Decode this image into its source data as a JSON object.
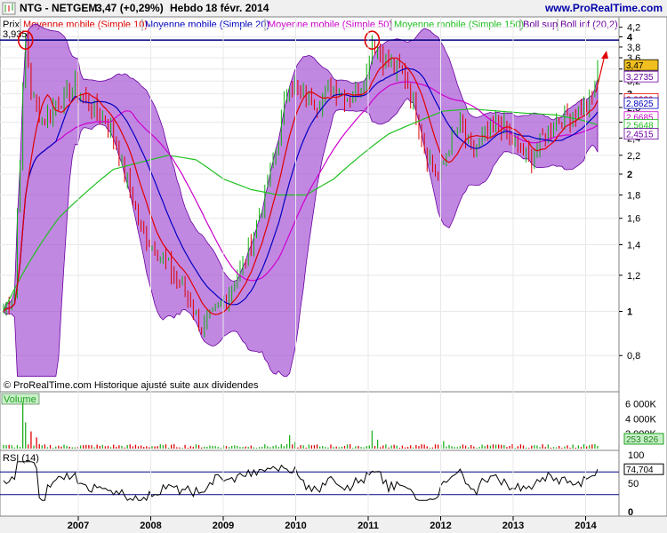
{
  "header": {
    "title": "NTG - NETGEM",
    "price_change": "3,47 (+0,29%)",
    "period": "Hebdo",
    "date": "18 févr. 2014",
    "brand": "www.ProRealTime.com"
  },
  "legend": {
    "prix": "Prix",
    "items": [
      {
        "label": "Moyenne mobile (Simple 10)",
        "color": "#e00000"
      },
      {
        "label": "Moyenne mobile (Simple 20)",
        "color": "#0000c0"
      },
      {
        "label": "Moyenne mobile (Simple 50)",
        "color": "#cc00cc"
      },
      {
        "label": "Moyenne mobile (Simple 150)",
        "color": "#20c020"
      },
      {
        "label": "Boll sup",
        "color": "#6a00a0"
      },
      {
        "label": "Boll inf (20,2)",
        "color": "#6a00a0"
      }
    ]
  },
  "footer_note": "© ProRealTime.com  Historique ajusté suite aux dividendes",
  "chart_data": [
    {
      "type": "candlestick",
      "name": "price",
      "x_labels": [
        "2007",
        "2008",
        "2009",
        "2010",
        "2011",
        "2012",
        "2013",
        "2014"
      ],
      "y_ticks": [
        "0,8",
        "1",
        "1,2",
        "1,4",
        "1,6",
        "1,8",
        "2",
        "2,2",
        "2,4",
        "2,6",
        "2,8",
        "3",
        "3,2",
        "3,4",
        "3,6",
        "3,8",
        "4",
        "4,2"
      ],
      "ylim": [
        0.7,
        4.25
      ],
      "y_scale": "log",
      "resistance_level": 3.935,
      "resistance_label": "3,935",
      "value_tags": [
        {
          "label": "3,47",
          "value": 3.47,
          "color": "#000000",
          "bg": "#f0c020"
        },
        {
          "label": "3,2735",
          "value": 3.2735,
          "color": "#6a00a0",
          "bg": "#ffffff"
        },
        {
          "label": "2,9239",
          "value": 2.9239,
          "color": "#e00000",
          "bg": "#ffffff"
        },
        {
          "label": "2,8625",
          "value": 2.8625,
          "color": "#0000c0",
          "bg": "#ffffff"
        },
        {
          "label": "2,6685",
          "value": 2.6685,
          "color": "#cc00cc",
          "bg": "#ffffff"
        },
        {
          "label": "2,5648",
          "value": 2.5648,
          "color": "#20c020",
          "bg": "#ffffff"
        },
        {
          "label": "2,4515",
          "value": 2.4515,
          "color": "#6a00a0",
          "bg": "#ffffff"
        }
      ],
      "price_keypoints": [
        [
          0,
          1.0
        ],
        [
          4,
          1.1
        ],
        [
          6,
          2.2
        ],
        [
          8,
          3.935
        ],
        [
          10,
          3.0
        ],
        [
          14,
          2.6
        ],
        [
          20,
          2.9
        ],
        [
          26,
          3.1
        ],
        [
          32,
          2.8
        ],
        [
          38,
          2.6
        ],
        [
          44,
          2.0
        ],
        [
          50,
          1.5
        ],
        [
          56,
          1.35
        ],
        [
          62,
          1.2
        ],
        [
          68,
          1.05
        ],
        [
          72,
          0.92
        ],
        [
          76,
          0.98
        ],
        [
          82,
          1.1
        ],
        [
          88,
          1.3
        ],
        [
          94,
          1.7
        ],
        [
          100,
          2.4
        ],
        [
          104,
          3.2
        ],
        [
          108,
          3.0
        ],
        [
          114,
          2.9
        ],
        [
          120,
          3.1
        ],
        [
          126,
          2.95
        ],
        [
          132,
          3.3
        ],
        [
          134,
          3.935
        ],
        [
          138,
          3.6
        ],
        [
          142,
          3.4
        ],
        [
          146,
          3.3
        ],
        [
          150,
          2.7
        ],
        [
          154,
          2.2
        ],
        [
          158,
          1.95
        ],
        [
          162,
          2.3
        ],
        [
          166,
          2.6
        ],
        [
          170,
          2.2
        ],
        [
          174,
          2.4
        ],
        [
          180,
          2.6
        ],
        [
          186,
          2.3
        ],
        [
          192,
          2.15
        ],
        [
          196,
          2.4
        ],
        [
          200,
          2.6
        ],
        [
          206,
          2.7
        ],
        [
          212,
          2.8
        ],
        [
          214,
          2.95
        ],
        [
          216,
          3.47
        ]
      ],
      "ma150_keypoints": [
        [
          0,
          1.0
        ],
        [
          20,
          1.6
        ],
        [
          40,
          2.05
        ],
        [
          60,
          2.2
        ],
        [
          70,
          2.15
        ],
        [
          80,
          1.95
        ],
        [
          90,
          1.85
        ],
        [
          100,
          1.8
        ],
        [
          110,
          1.8
        ],
        [
          120,
          1.95
        ],
        [
          130,
          2.2
        ],
        [
          140,
          2.45
        ],
        [
          150,
          2.6
        ],
        [
          160,
          2.75
        ],
        [
          170,
          2.78
        ],
        [
          180,
          2.75
        ],
        [
          190,
          2.72
        ],
        [
          200,
          2.7
        ],
        [
          210,
          2.63
        ],
        [
          216,
          2.5648
        ]
      ]
    },
    {
      "type": "bar",
      "name": "volume",
      "label": "Volume",
      "y_ticks": [
        "2 000K",
        "4 000K",
        "6 000K"
      ],
      "ylim": [
        0,
        7000000
      ],
      "last_value_label": "253 826",
      "spikes": [
        {
          "idx": 7,
          "value": 6200000
        },
        {
          "idx": 8,
          "value": 3500000
        },
        {
          "idx": 10,
          "value": 2300000
        },
        {
          "idx": 12,
          "value": 1500000
        },
        {
          "idx": 104,
          "value": 1800000
        },
        {
          "idx": 106,
          "value": 900000
        },
        {
          "idx": 134,
          "value": 2400000
        },
        {
          "idx": 136,
          "value": 1200000
        },
        {
          "idx": 160,
          "value": 1000000
        },
        {
          "idx": 215,
          "value": 600000
        }
      ]
    },
    {
      "type": "line",
      "name": "rsi",
      "label": "RSI (14)",
      "y_ticks": [
        "0",
        "50",
        "100"
      ],
      "ylim": [
        0,
        100
      ],
      "levels": [
        30,
        70
      ],
      "last_value_label": "74,704",
      "last_value": 74.704
    }
  ]
}
